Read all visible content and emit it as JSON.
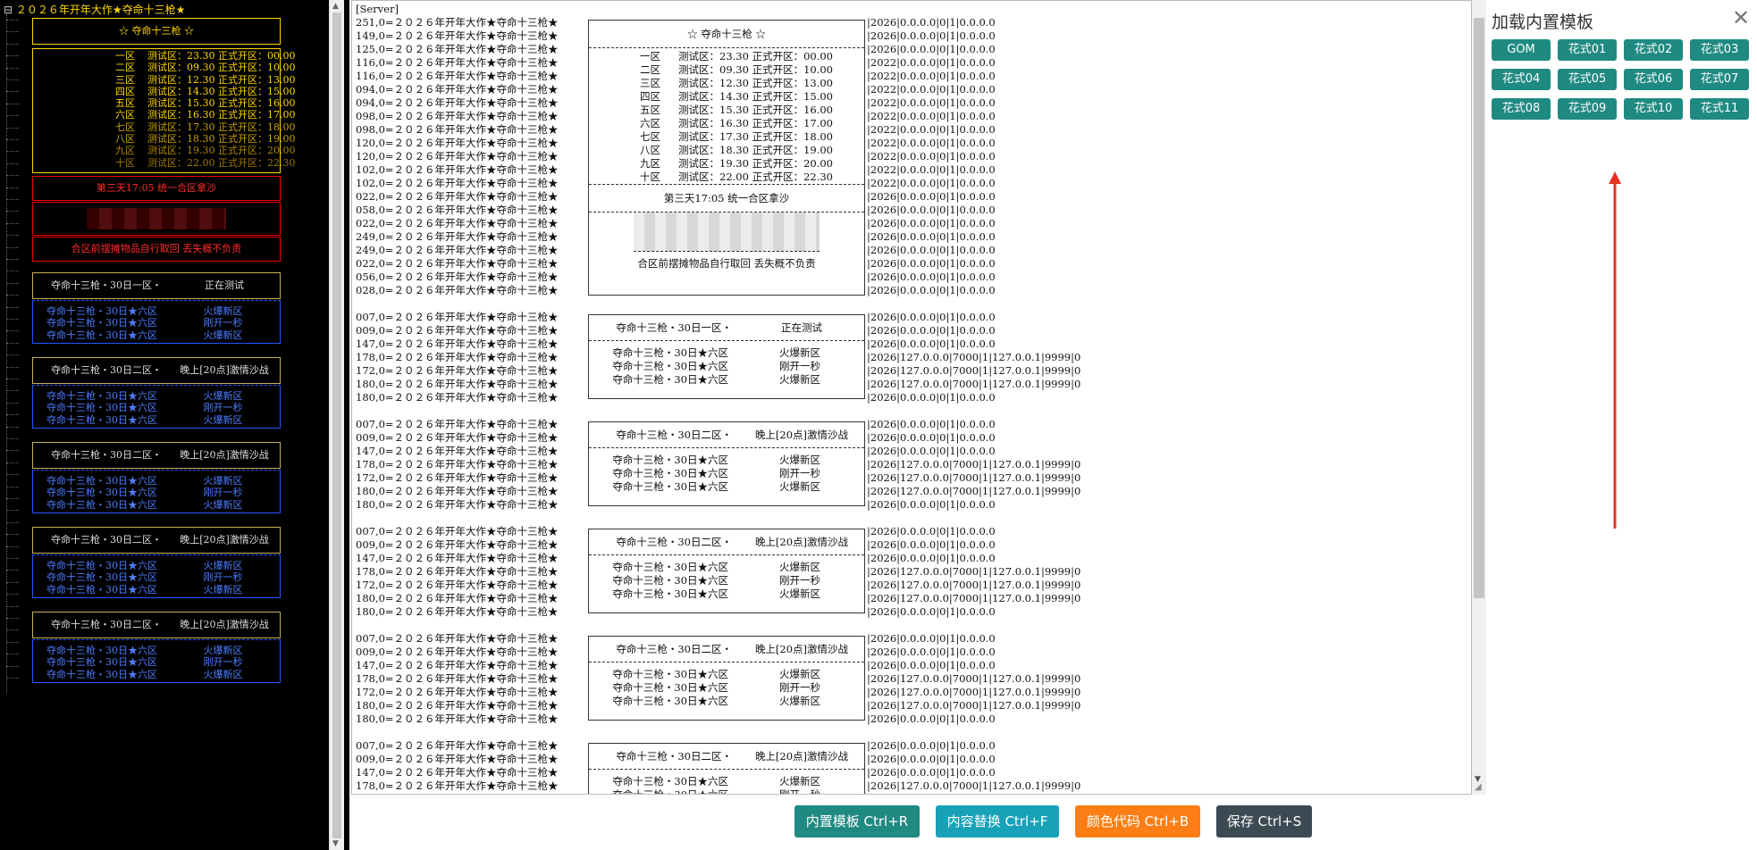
{
  "tree_title": "２０２６年开年大作★夺命十三枪★",
  "left_boxes": [
    {
      "title": "☆ 夺命十三枪 ☆",
      "color": "#ffd700",
      "rows": [
        [
          "一区",
          "测试区：23.30 正式开区：00.00"
        ],
        [
          "二区",
          "测试区：09.30 正式开区：10.00"
        ],
        [
          "三区",
          "测试区：12.30 正式开区：13.00"
        ],
        [
          "四区",
          "测试区：14.30 正式开区：15.00"
        ],
        [
          "五区",
          "测试区：15.30 正式开区：16.00"
        ],
        [
          "六区",
          "测试区：16.30 正式开区：17.00"
        ],
        [
          "七区",
          "测试区：17.30 正式开区：18.00"
        ],
        [
          "八区",
          "测试区：18.30 正式开区：19.00"
        ],
        [
          "九区",
          "测试区：19.30 正式开区：20.00"
        ],
        [
          "十区",
          "测试区：22.00 正式开区：22.30"
        ]
      ],
      "row_colors": [
        "#ffd700",
        "#ffd700",
        "#ffd700",
        "#ffd700",
        "#ffd700",
        "#ffd700",
        "#c9a300",
        "#c9a300",
        "#b08800",
        "#a07800"
      ]
    },
    {
      "notice": "第三天17:05 统一合区拿沙",
      "notice2": "合区前摆摊物品自行取回 丢失概不负责"
    }
  ],
  "groups": [
    {
      "head_l": "夺命十三枪・30日一区・",
      "head_r": "正在测试",
      "rows": [
        [
          "夺命十三枪・30日★六区",
          "火爆新区"
        ],
        [
          "夺命十三枪・30日★六区",
          "刚开一秒"
        ],
        [
          "夺命十三枪・30日★六区",
          "火爆新区"
        ]
      ]
    },
    {
      "head_l": "夺命十三枪・30日二区・",
      "head_r": "晚上[20点]激情沙战",
      "rows": [
        [
          "夺命十三枪・30日★六区",
          "火爆新区"
        ],
        [
          "夺命十三枪・30日★六区",
          "刚开一秒"
        ],
        [
          "夺命十三枪・30日★六区",
          "火爆新区"
        ]
      ]
    },
    {
      "head_l": "夺命十三枪・30日二区・",
      "head_r": "晚上[20点]激情沙战",
      "rows": [
        [
          "夺命十三枪・30日★六区",
          "火爆新区"
        ],
        [
          "夺命十三枪・30日★六区",
          "刚开一秒"
        ],
        [
          "夺命十三枪・30日★六区",
          "火爆新区"
        ]
      ]
    },
    {
      "head_l": "夺命十三枪・30日二区・",
      "head_r": "晚上[20点]激情沙战",
      "rows": [
        [
          "夺命十三枪・30日★六区",
          "火爆新区"
        ],
        [
          "夺命十三枪・30日★六区",
          "刚开一秒"
        ],
        [
          "夺命十三枪・30日★六区",
          "火爆新区"
        ]
      ]
    },
    {
      "head_l": "夺命十三枪・30日二区・",
      "head_r": "晚上[20点]激情沙战",
      "rows": [
        [
          "夺命十三枪・30日★六区",
          "火爆新区"
        ],
        [
          "夺命十三枪・30日★六区",
          "刚开一秒"
        ],
        [
          "夺命十三枪・30日★六区",
          "火爆新区"
        ]
      ]
    }
  ],
  "editor": {
    "header": "[Server]",
    "title_text": "２０２６年开年大作★夺命十三枪★",
    "block1_prefixes": [
      "251",
      "149",
      "125",
      "116",
      "116",
      "094",
      "094",
      "098",
      "098",
      "120",
      "120",
      "102",
      "102",
      "022",
      "058",
      "022",
      "249",
      "249",
      "022",
      "056",
      "028"
    ],
    "block1_suffix": [
      "2026|0.0.0.0|0|1|0.0.0.0",
      "2026|0.0.0.0|0|1|0.0.0.0",
      "2026|0.0.0.0|0|1|0.0.0.0",
      "2022|0.0.0.0|0|1|0.0.0.0",
      "2022|0.0.0.0|0|1|0.0.0.0",
      "2022|0.0.0.0|0|1|0.0.0.0",
      "2022|0.0.0.0|0|1|0.0.0.0",
      "2022|0.0.0.0|0|1|0.0.0.0",
      "2022|0.0.0.0|0|1|0.0.0.0",
      "2022|0.0.0.0|0|1|0.0.0.0",
      "2022|0.0.0.0|0|1|0.0.0.0",
      "2022|0.0.0.0|0|1|0.0.0.0",
      "2022|0.0.0.0|0|1|0.0.0.0",
      "2026|0.0.0.0|0|1|0.0.0.0",
      "2026|0.0.0.0|0|1|0.0.0.0",
      "2026|0.0.0.0|0|1|0.0.0.0",
      "2026|0.0.0.0|0|1|0.0.0.0",
      "2026|0.0.0.0|0|1|0.0.0.0",
      "2026|0.0.0.0|0|1|0.0.0.0",
      "2026|0.0.0.0|0|1|0.0.0.0",
      "2026|0.0.0.0|0|1|0.0.0.0"
    ],
    "block_title": "☆ 夺命十三枪 ☆",
    "block_notice": "第三天17:05 统一合区拿沙",
    "block_notice2": "合区前摆摊物品自行取回 丢失概不负责",
    "group_prefixes": [
      "007",
      "009",
      "147",
      "178",
      "172",
      "180",
      "180"
    ],
    "group_suffix": [
      "2026|0.0.0.0|0|1|0.0.0.0",
      "2026|0.0.0.0|0|1|0.0.0.0",
      "2026|0.0.0.0|0|1|0.0.0.0",
      "2026|127.0.0.0|7000|1|127.0.0.1|9999|0",
      "2026|127.0.0.0|7000|1|127.0.0.1|9999|0",
      "2026|127.0.0.0|7000|1|127.0.0.1|9999|0",
      "2026|0.0.0.0|0|1|0.0.0.0"
    ]
  },
  "panel": {
    "title": "加载内置模板",
    "close_icon": "close-icon",
    "buttons": [
      "GOM",
      "花式01",
      "花式02",
      "花式03",
      "花式04",
      "花式05",
      "花式06",
      "花式07",
      "花式08",
      "花式09",
      "花式10",
      "花式11"
    ],
    "button_color": "#1f8a82"
  },
  "bottom_buttons": [
    {
      "label": "内置模板 Ctrl+R",
      "color": "#1f8a82"
    },
    {
      "label": "内容替换 Ctrl+F",
      "color": "#17a2b8"
    },
    {
      "label": "颜色代码 Ctrl+B",
      "color": "#fd7e14"
    },
    {
      "label": "保存 Ctrl+S",
      "color": "#3c4a54"
    }
  ],
  "annotation_color": "#e53323"
}
